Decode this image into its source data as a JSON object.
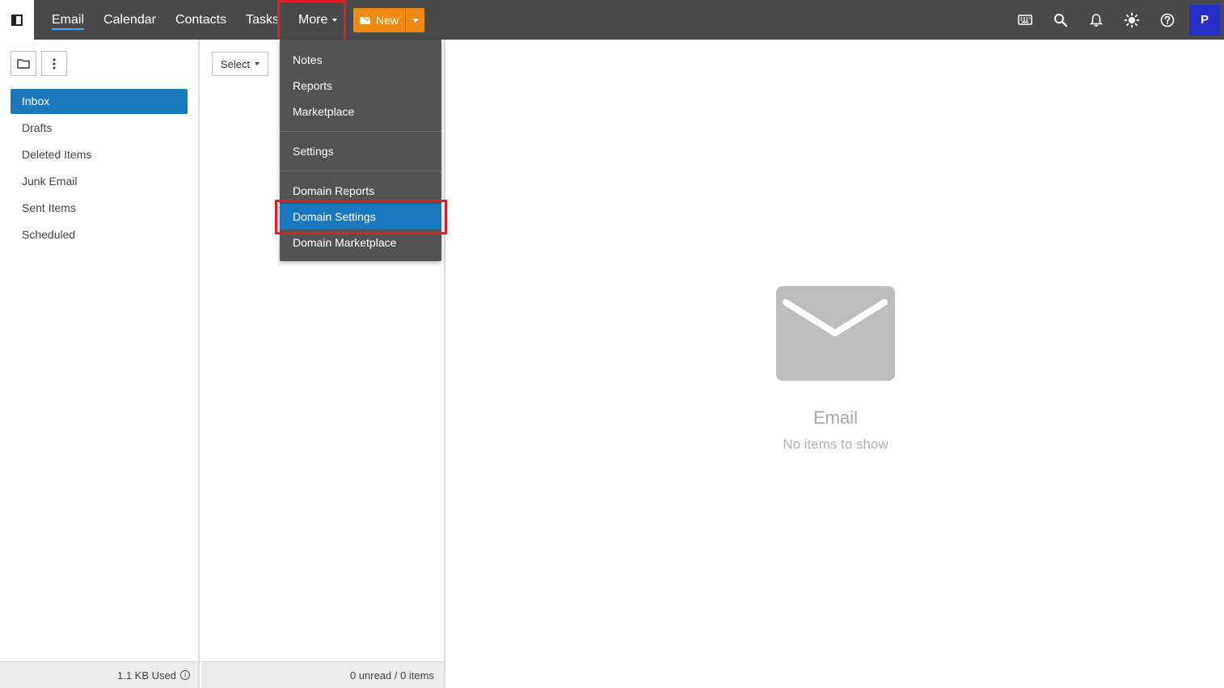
{
  "topbar": {
    "nav": {
      "email": "Email",
      "calendar": "Calendar",
      "contacts": "Contacts",
      "tasks": "Tasks",
      "more": "More"
    },
    "new_label": "New",
    "avatar_initial": "P",
    "icons": [
      "keyboard-icon",
      "search-icon",
      "bell-icon",
      "sun-icon",
      "help-icon"
    ]
  },
  "folders": {
    "items": [
      "Inbox",
      "Drafts",
      "Deleted Items",
      "Junk Email",
      "Sent Items",
      "Scheduled"
    ],
    "active": "Inbox",
    "storage_used": "1.1 KB Used"
  },
  "list": {
    "select_label": "Select",
    "status": "0 unread / 0 items"
  },
  "preview": {
    "title": "Email",
    "subtitle": "No items to show"
  },
  "more_menu": {
    "groups": [
      [
        "Notes",
        "Reports",
        "Marketplace"
      ],
      [
        "Settings"
      ],
      [
        "Domain Reports",
        "Domain Settings",
        "Domain Marketplace"
      ]
    ],
    "selected": "Domain Settings"
  },
  "colors": {
    "topbar": "#4a4a4a",
    "accent_blue": "#1a78bd",
    "new_button": "#ef8a12",
    "avatar": "#2530c9",
    "highlight_box": "#e21d2a"
  }
}
